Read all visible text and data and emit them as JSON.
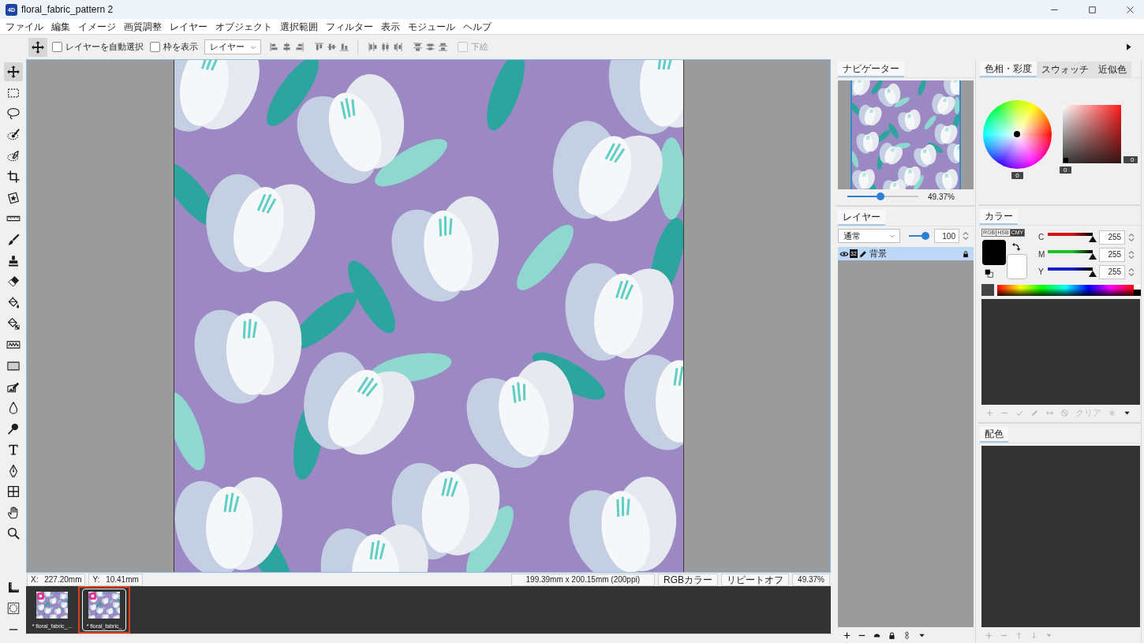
{
  "window": {
    "app_badge": "4D",
    "title": "floral_fabric_pattern 2"
  },
  "menu": [
    "ファイル",
    "編集",
    "イメージ",
    "画質調整",
    "レイヤー",
    "オブジェクト",
    "選択範囲",
    "フィルター",
    "表示",
    "モジュール",
    "ヘルプ"
  ],
  "toolbar": {
    "auto_select": {
      "label": "レイヤーを自動選択",
      "checked": false
    },
    "show_bounds": {
      "label": "枠を表示",
      "checked": false
    },
    "target": {
      "value": "レイヤー"
    },
    "draft": {
      "label": "下絵",
      "checked": false,
      "disabled": true
    }
  },
  "tools": [
    {
      "selected": true
    },
    {
      "selected": false
    },
    {
      "selected": false
    },
    {
      "selected": false
    },
    {
      "selected": false
    },
    {
      "selected": false
    },
    {
      "selected": false
    },
    {
      "selected": false
    },
    {
      "selected": false
    },
    {
      "selected": false
    },
    {
      "selected": false
    },
    {
      "selected": false
    },
    {
      "selected": false
    },
    {
      "selected": false
    },
    {
      "selected": false
    },
    {
      "selected": false
    },
    {
      "selected": false
    },
    {
      "selected": false
    },
    {
      "selected": false
    },
    {
      "selected": false
    },
    {
      "selected": false
    },
    {
      "selected": false
    },
    {
      "selected": false
    }
  ],
  "status_bar": {
    "x": {
      "label": "X:",
      "value": "227.20mm"
    },
    "y": {
      "label": "Y:",
      "value": "10.41mm"
    },
    "size": "199.39mm x 200.15mm (200ppi)",
    "color_mode": "RGBカラー",
    "repeat": "リピートオフ",
    "zoom": "49.37%"
  },
  "documents": [
    {
      "name": "* floral_fabric_...",
      "selected": false
    },
    {
      "name": "* floral_fabric_",
      "selected": true
    }
  ],
  "navigator": {
    "tab": "ナビゲーター",
    "zoom_slider": {
      "level": 0.47
    },
    "zoom": "49.37%"
  },
  "layers": {
    "tab": "レイヤー",
    "blend_mode": "通常",
    "opacity": {
      "level": 0.8,
      "value": "100"
    },
    "items": [
      {
        "name": "背景",
        "bit_depth": "32",
        "visible": true,
        "locked": true,
        "selected": true
      }
    ]
  },
  "color_picker": {
    "tabs": [
      {
        "label": "色相・彩度",
        "selected": true
      },
      {
        "label": "スウォッチ",
        "selected": false
      },
      {
        "label": "近似色",
        "selected": false
      }
    ],
    "wheel_reading": "0",
    "square_right_reading": "0",
    "square_bottom_reading": "0"
  },
  "color": {
    "tab": "カラー",
    "modes": [
      {
        "label": "RGB",
        "selected": false
      },
      {
        "label": "HSB",
        "selected": false
      },
      {
        "label": "CMY",
        "selected": true
      }
    ],
    "swatches": [
      {
        "kind": "foreground",
        "color": "#000000"
      },
      {
        "kind": "background",
        "color": "#ffffff"
      },
      {
        "kind": "recent",
        "color": "#444444"
      }
    ],
    "channels": [
      {
        "name": "C",
        "color": "#d01414",
        "level": 1,
        "value": "255"
      },
      {
        "name": "M",
        "color": "#1fbf2a",
        "level": 1,
        "value": "255"
      },
      {
        "name": "Y",
        "color": "#1420c8",
        "level": 1,
        "value": "255"
      }
    ],
    "palette_toolbar": {
      "clear": "クリア",
      "disabled": true
    }
  },
  "harmony": {
    "tab": "配色",
    "toolbar": {
      "disabled": true
    }
  }
}
